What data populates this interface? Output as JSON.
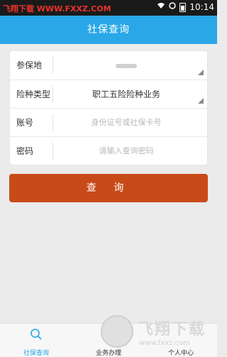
{
  "status_bar": {
    "watermark": "飞翔下载 WWW.FXXZ.COM",
    "time": "10:14"
  },
  "header": {
    "title": "社保查询"
  },
  "form": {
    "rows": [
      {
        "label": "参保地",
        "value": "",
        "placeholder": ""
      },
      {
        "label": "险种类型",
        "value": "职工五险险种业务",
        "placeholder": ""
      },
      {
        "label": "账号",
        "value": "",
        "placeholder": "身份证号或社保卡号"
      },
      {
        "label": "密码",
        "value": "",
        "placeholder": "请输入查询密码"
      }
    ]
  },
  "query_button": {
    "label": "查 询"
  },
  "tab_bar": {
    "tabs": [
      {
        "label": "社保查询",
        "icon": "search-icon",
        "active": true
      },
      {
        "label": "业务办理",
        "icon": "briefcase-icon",
        "active": false
      },
      {
        "label": "个人中心",
        "icon": "user-icon",
        "active": false
      }
    ]
  },
  "watermark": {
    "brand": "飞翔下载",
    "url": "www.fxxz.com"
  },
  "colors": {
    "header": "#29a7e6",
    "button": "#c94a19",
    "active_tab": "#29a7e6"
  }
}
